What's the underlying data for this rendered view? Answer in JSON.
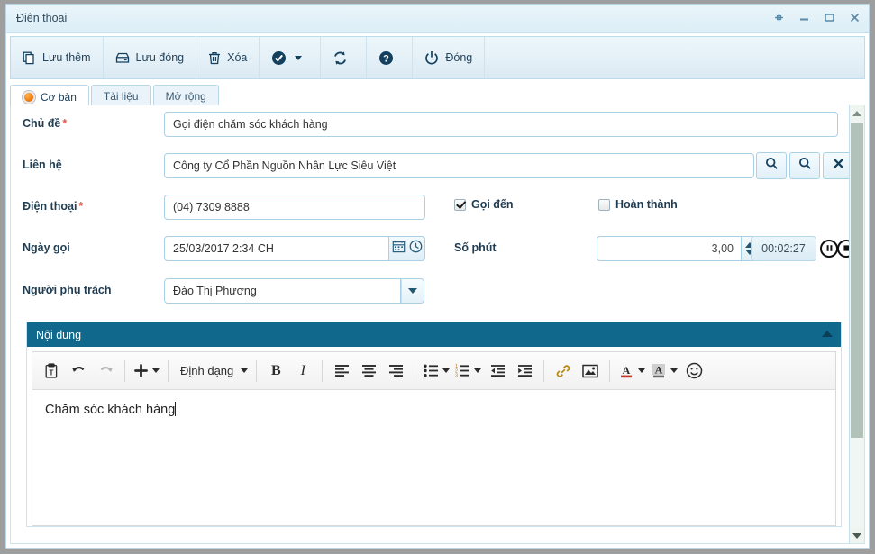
{
  "window": {
    "title": "Điện thoại",
    "controls": [
      {
        "name": "pin-icon",
        "label": "Pin"
      },
      {
        "name": "minimize-icon",
        "label": "Minimize"
      },
      {
        "name": "maximize-icon",
        "label": "Maximize"
      },
      {
        "name": "close-icon",
        "label": "Close"
      }
    ]
  },
  "toolbar": {
    "save_add_label": "Lưu thêm",
    "save_close_label": "Lưu đóng",
    "delete_label": "Xóa",
    "approve_label": "",
    "refresh_label": "",
    "help_label": "",
    "close_label": "Đóng",
    "icons": {
      "save_add": "copy-icon",
      "save_close": "save-icon",
      "delete": "trash-icon",
      "approve": "check-circle-icon",
      "refresh": "refresh-icon",
      "help": "help-circle-icon",
      "close": "power-icon"
    }
  },
  "tabs": [
    {
      "label": "Cơ bản",
      "active": true
    },
    {
      "label": "Tài liệu",
      "active": false
    },
    {
      "label": "Mở rộng",
      "active": false
    }
  ],
  "form": {
    "subject": {
      "label": "Chủ đề",
      "required": "*",
      "value": "Gọi điện chăm sóc khách hàng"
    },
    "contact": {
      "label": "Liên hệ",
      "value": "Công ty Cổ Phần Nguồn Nhân Lực Siêu Việt",
      "buttons": [
        "search-icon",
        "search-icon",
        "clear-icon"
      ]
    },
    "phone": {
      "label": "Điện thoại",
      "required": "*",
      "value": "(04) 7309 8888"
    },
    "call_date": {
      "label": "Ngày gọi",
      "value": "25/03/2017 2:34 CH",
      "icons": [
        "calendar-icon",
        "clock-icon"
      ]
    },
    "assignee": {
      "label": "Người phụ trách",
      "value": "Đào Thị Phương"
    },
    "incoming": {
      "label": "Gọi đến",
      "checked": true
    },
    "completed": {
      "label": "Hoàn thành",
      "checked": false
    },
    "minutes": {
      "label": "Số phút",
      "value": "3,00"
    },
    "timer": {
      "value": "00:02:27",
      "pause": "pause-icon",
      "stop": "stop-icon"
    }
  },
  "content_panel": {
    "title": "Nội dung",
    "editor": {
      "format_label": "Định dạng",
      "body_text": "Chăm sóc khách hàng",
      "buttons": [
        "paste-icon",
        "undo-icon",
        "redo-icon",
        "insert-icon",
        "format-dropdown",
        "bold-icon",
        "italic-icon",
        "align-left-icon",
        "align-center-icon",
        "align-right-icon",
        "bullet-list-icon",
        "numbered-list-icon",
        "outdent-icon",
        "indent-icon",
        "link-icon",
        "image-icon",
        "text-color-icon",
        "background-color-icon",
        "emoji-icon"
      ]
    }
  },
  "colors": {
    "titlebar": "#e3f1f8",
    "toolbar": "#e6f2f8",
    "panel_header": "#10688c",
    "accent_orange": "#f07d12",
    "required_red": "#e2574c",
    "field_border": "#a9d0e5"
  }
}
